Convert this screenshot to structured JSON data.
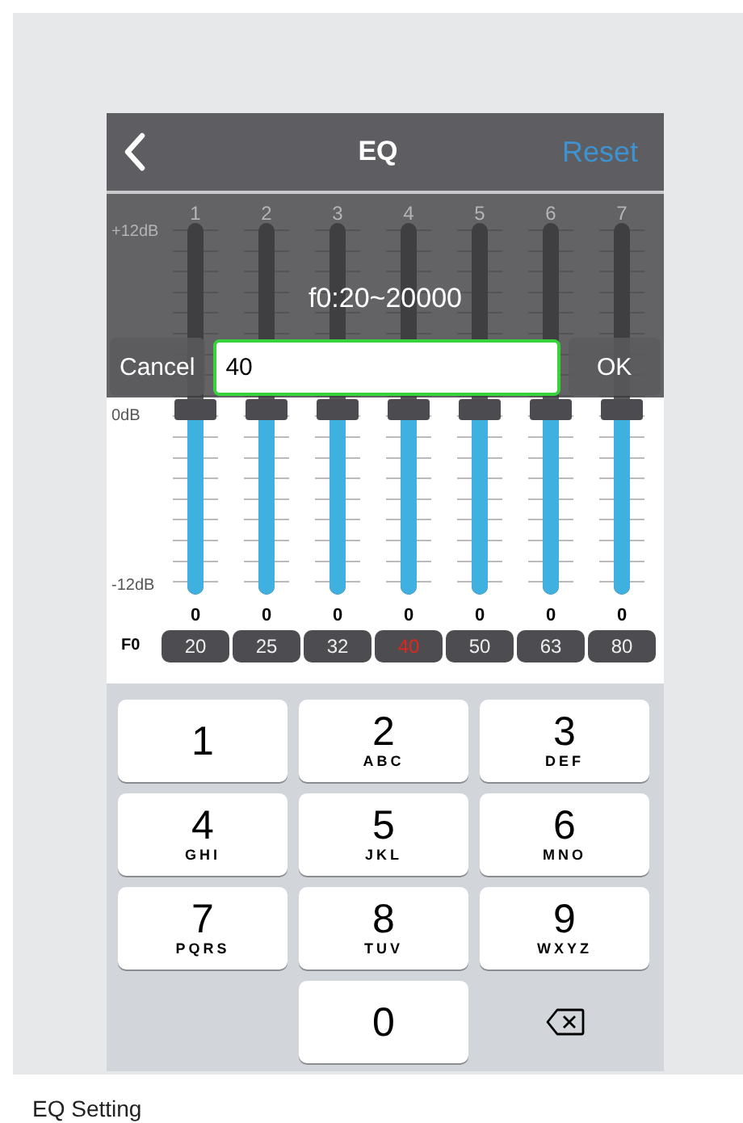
{
  "nav": {
    "title": "EQ",
    "reset": "Reset"
  },
  "dialog": {
    "title": "f0:20~20000",
    "cancel": "Cancel",
    "value": "40",
    "ok": "OK"
  },
  "scale": [
    "+12dB",
    "0dB",
    "-12dB"
  ],
  "f0_label": "F0",
  "bands": [
    {
      "number": "1",
      "level": 0.5,
      "value": "0",
      "f0": "20",
      "selected": false
    },
    {
      "number": "2",
      "level": 0.5,
      "value": "0",
      "f0": "25",
      "selected": false
    },
    {
      "number": "3",
      "level": 0.5,
      "value": "0",
      "f0": "32",
      "selected": false
    },
    {
      "number": "4",
      "level": 0.5,
      "value": "0",
      "f0": "40",
      "selected": true
    },
    {
      "number": "5",
      "level": 0.5,
      "value": "0",
      "f0": "50",
      "selected": false
    },
    {
      "number": "6",
      "level": 0.5,
      "value": "0",
      "f0": "63",
      "selected": false
    },
    {
      "number": "7",
      "level": 0.5,
      "value": "0",
      "f0": "80",
      "selected": false
    }
  ],
  "keypad": [
    {
      "kind": "digit",
      "digit": "1"
    },
    {
      "kind": "digit",
      "digit": "2",
      "letters": "ABC"
    },
    {
      "kind": "digit",
      "digit": "3",
      "letters": "DEF"
    },
    {
      "kind": "digit",
      "digit": "4",
      "letters": "GHI"
    },
    {
      "kind": "digit",
      "digit": "5",
      "letters": "JKL"
    },
    {
      "kind": "digit",
      "digit": "6",
      "letters": "MNO"
    },
    {
      "kind": "digit",
      "digit": "7",
      "letters": "PQRS"
    },
    {
      "kind": "digit",
      "digit": "8",
      "letters": "TUV"
    },
    {
      "kind": "digit",
      "digit": "9",
      "letters": "WXYZ"
    },
    {
      "kind": "blank"
    },
    {
      "kind": "digit",
      "digit": "0"
    },
    {
      "kind": "delete"
    }
  ],
  "caption": "EQ Setting"
}
